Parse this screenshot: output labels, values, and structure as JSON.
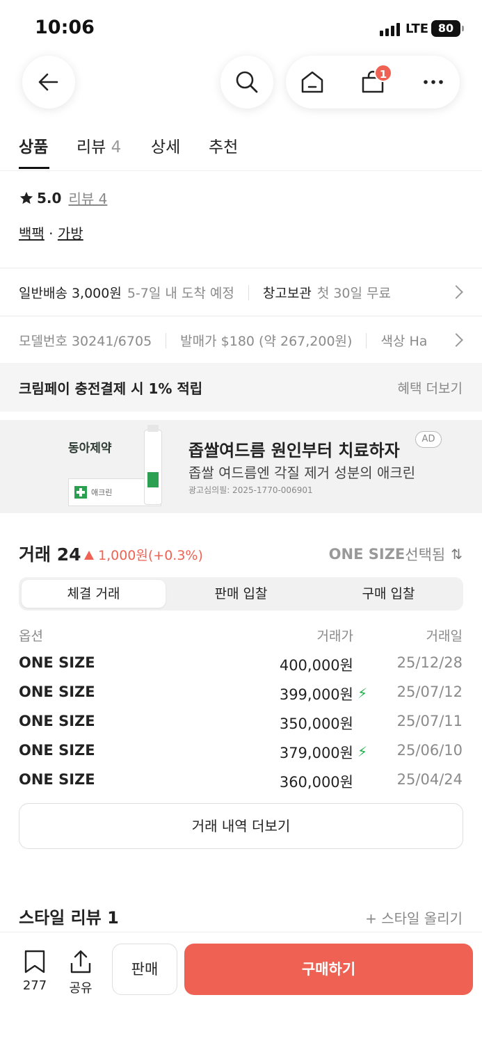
{
  "status_bar": {
    "time": "10:06",
    "network": "LTE",
    "battery": "80"
  },
  "header": {
    "cart_badge": "1"
  },
  "tabs": [
    {
      "label": "상품",
      "count": ""
    },
    {
      "label": "리뷰",
      "count": "4"
    },
    {
      "label": "상세",
      "count": ""
    },
    {
      "label": "추천",
      "count": ""
    }
  ],
  "rating": {
    "score": "5.0",
    "review_link": "리뷰 4"
  },
  "categories": {
    "first": "백팩",
    "sep": " · ",
    "second": "가방"
  },
  "delivery": {
    "label": "일반배송 3,000원",
    "eta": "5-7일 내 도착 예정",
    "storage_label": "창고보관",
    "storage_note": "첫 30일 무료"
  },
  "product_info": {
    "model": "모델번호 30241/6705",
    "release_price": "발매가 $180 (약 267,200원)",
    "color": "색상 Ha"
  },
  "benefit": {
    "text": "크림페이 충전결제 시 1% 적립",
    "more": "혜택 더보기"
  },
  "ad": {
    "brand": "동아제약",
    "product_label": "애크린",
    "title": "좁쌀여드름 원인부터 치료하자",
    "subtitle": "좁쌀 여드름엔 각질 제거 성분의 애크린",
    "fine_print": "광고심의필: 2025-1770-006901",
    "tag": "AD"
  },
  "trades": {
    "title": "거래 24",
    "change": "1,000원(+0.3%)",
    "size_selected": "ONE SIZE",
    "size_suffix": "선택됨",
    "segments": [
      "체결 거래",
      "판매 입찰",
      "구매 입찰"
    ],
    "columns": {
      "option": "옵션",
      "price": "거래가",
      "date": "거래일"
    },
    "rows": [
      {
        "option": "ONE SIZE",
        "price": "400,000원",
        "date": "25/12/28",
        "fast": false
      },
      {
        "option": "ONE SIZE",
        "price": "399,000원",
        "date": "25/07/12",
        "fast": true
      },
      {
        "option": "ONE SIZE",
        "price": "350,000원",
        "date": "25/07/11",
        "fast": false
      },
      {
        "option": "ONE SIZE",
        "price": "379,000원",
        "date": "25/06/10",
        "fast": true
      },
      {
        "option": "ONE SIZE",
        "price": "360,000원",
        "date": "25/04/24",
        "fast": false
      }
    ],
    "more_button": "거래 내역 더보기"
  },
  "style_review": {
    "title": "스타일 리뷰 1",
    "upload": "+ 스타일 올리기"
  },
  "bottom_bar": {
    "bookmark_count": "277",
    "share_label": "공유",
    "sell_label": "판매",
    "buy_label": "구매하기"
  },
  "colors": {
    "accent": "#ef6253",
    "fast_bolt": "#22b14c"
  },
  "icons": [
    "back-arrow-icon",
    "search-icon",
    "home-icon",
    "shopping-bag-icon",
    "more-dots-icon",
    "star-icon",
    "chevron-right-icon",
    "bolt-icon",
    "sort-icon",
    "bookmark-icon",
    "share-icon"
  ]
}
